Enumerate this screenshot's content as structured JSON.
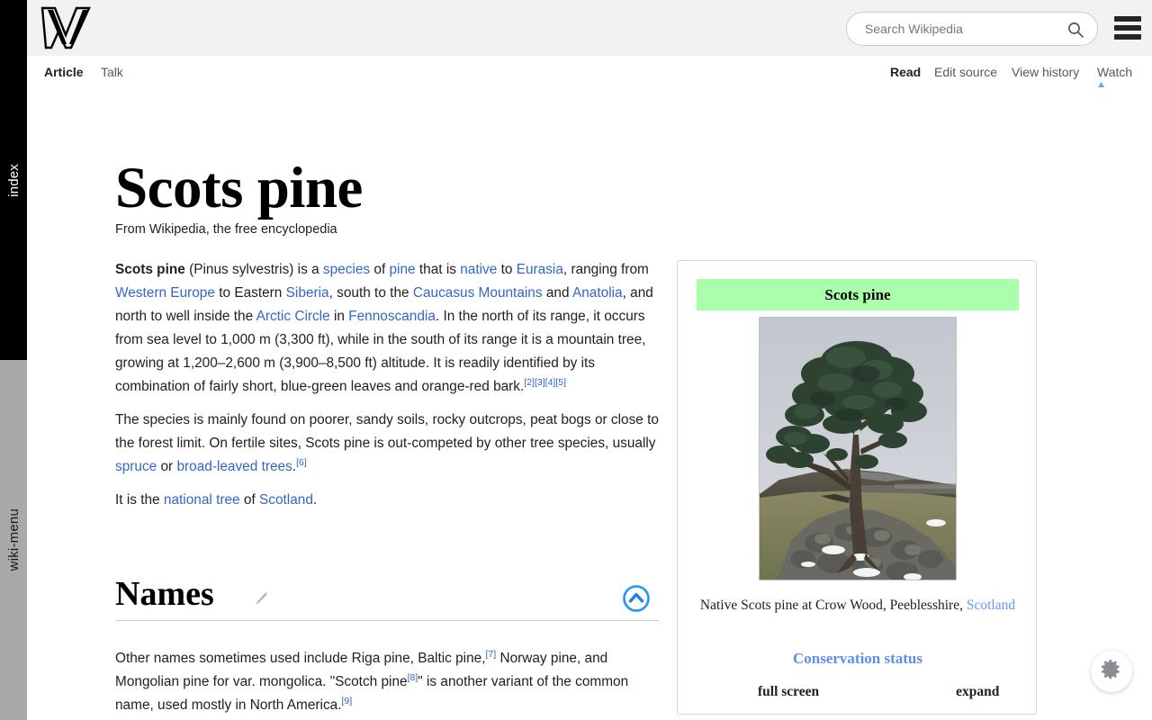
{
  "rails": {
    "index_label": "index",
    "wikimenu_label": "wiki-menu"
  },
  "header": {
    "logo_name": "wikipedia-w-logo",
    "search": {
      "placeholder": "Search Wikipedia",
      "value": "",
      "icon": "search-icon"
    },
    "menu_icon": "hamburger-menu-icon"
  },
  "tabs": {
    "left": [
      {
        "label": "Article",
        "active": true
      },
      {
        "label": "Talk",
        "active": false
      }
    ],
    "right": [
      {
        "label": "Read",
        "active": true
      },
      {
        "label": "Edit source",
        "active": false
      },
      {
        "label": "View history",
        "active": false
      },
      {
        "label": "Watch",
        "active": false
      }
    ]
  },
  "article": {
    "title": "Scots pine",
    "tagline": "From Wikipedia, the free encyclopedia",
    "p1": {
      "bold_lead": "Scots pine",
      "t1": " (Pinus sylvestris) is a ",
      "l1": "species",
      "t2": " of ",
      "l2": "pine",
      "t3": " that is ",
      "l3": "native",
      "t4": " to ",
      "l4": "Eurasia",
      "t5": ", ranging from ",
      "l5": "Western Europe",
      "t6": " to Eastern ",
      "l6": "Siberia",
      "t7": ", south to the ",
      "l7": "Caucasus Mountains",
      "t8": " and ",
      "l8": "Anatolia",
      "t9": ", and north to well inside the ",
      "l9": "Arctic Circle",
      "t10": " in ",
      "l10": "Fennoscandia",
      "t11": ". In the north of its range, it occurs from sea level to 1,000 m (3,300 ft), while in the south of its range it is a mountain tree, growing at 1,200–2,600 m (3,900–8,500 ft) altitude. It is readily identified by its combination of fairly short, blue-green leaves and orange-red bark.",
      "refs": [
        "[2]",
        "[3]",
        "[4]",
        "[5]"
      ]
    },
    "p2": {
      "t1": "The species is mainly found on poorer, sandy soils, rocky outcrops, peat bogs or close to the forest limit. On fertile sites, Scots pine is out-competed by other tree species, usually ",
      "l1": "spruce",
      "t2": " or ",
      "l2": "broad-leaved trees",
      "t3": ".",
      "refs": [
        "[6]"
      ]
    },
    "p3": {
      "t1": "It is the ",
      "l1": "national tree",
      "t2": " of ",
      "l2": "Scotland",
      "t3": "."
    },
    "section_names": {
      "heading": "Names",
      "edit_icon": "pencil-edit-icon",
      "scroll_top_icon": "chevron-up-circle-icon",
      "body": {
        "t1": "Other names sometimes used include Riga pine, Baltic pine,",
        "ref1": "[7]",
        "t2": " Norway pine, and Mongolian pine for var. mongolica. \"Scotch pine",
        "ref2": "[8]",
        "t3": "\" is another variant of the common name, used mostly in North America.",
        "ref3": "[9]"
      }
    }
  },
  "infobox": {
    "title": "Scots pine",
    "title_bg": "#aaffaa",
    "image_alt": "scots-pine-tree-photo",
    "caption_text": "Native Scots pine at Crow Wood, Peeblesshire, ",
    "caption_link": "Scotland",
    "conservation_status": "Conservation status",
    "actions": [
      {
        "label": "full screen"
      },
      {
        "label": "expand"
      }
    ]
  },
  "floating": {
    "settings_icon": "gear-icon"
  },
  "colors": {
    "link": "#3366cc",
    "link_soft": "#6699ee",
    "header_bg": "#f2f2f2",
    "rail_index_bg": "#000000",
    "rail_menu_bg": "#a9a9a9",
    "accent_blue": "#2196f3",
    "infobox_green": "#aaffaa"
  }
}
